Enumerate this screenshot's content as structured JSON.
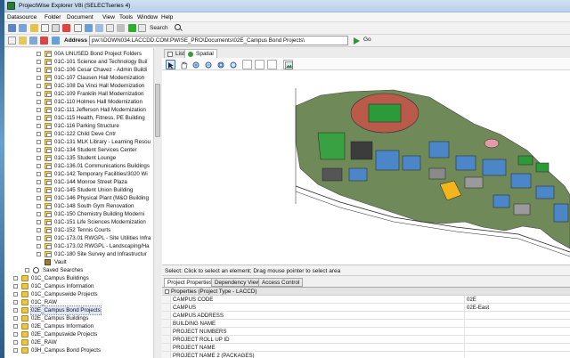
{
  "window": {
    "title": "ProjectWise Explorer V8i (SELECTseries 4)"
  },
  "menu": [
    "Datasource",
    "Folder",
    "Document",
    "View",
    "Tools",
    "Window",
    "Help"
  ],
  "toolbar": {
    "search_label": "Search",
    "address_label": "Address",
    "address_value": "pw:\\\\DOWN034.LACCDD.COM:PWISE_PRO\\Documents\\02E_Campus Bond Projects\\",
    "go_label": "Go"
  },
  "tree": {
    "items": [
      {
        "label": "00A UNUSED Bond Project Folders",
        "type": "project",
        "indent": 3,
        "expander": true
      },
      {
        "label": "01C-101 Science and Technology Buil",
        "type": "project",
        "indent": 3,
        "expander": true
      },
      {
        "label": "01C-106 Cesar Chavez - Admin Buildi",
        "type": "project",
        "indent": 3,
        "expander": true
      },
      {
        "label": "01C-107 Clausen Hall Modernization",
        "type": "project",
        "indent": 3,
        "expander": true
      },
      {
        "label": "01C-108 Da Vinci Hall Modernization",
        "type": "project",
        "indent": 3,
        "expander": true
      },
      {
        "label": "01C-109 Franklin Hall Modernization",
        "type": "project",
        "indent": 3,
        "expander": true
      },
      {
        "label": "01C-110 Holmes Hall Modernization",
        "type": "project",
        "indent": 3,
        "expander": true
      },
      {
        "label": "01C-111 Jefferson Hall Modernization",
        "type": "project",
        "indent": 3,
        "expander": true
      },
      {
        "label": "01C-115 Health, Fitness, PE Building",
        "type": "project",
        "indent": 3,
        "expander": true
      },
      {
        "label": "01C-116 Parking Structure",
        "type": "project",
        "indent": 3,
        "expander": true
      },
      {
        "label": "01C-122 Child Deve Cntr",
        "type": "project",
        "indent": 3,
        "expander": true
      },
      {
        "label": "01C-131 MLK Library - Learning Resou",
        "type": "project",
        "indent": 3,
        "expander": true
      },
      {
        "label": "01C-134 Student Services Center",
        "type": "project",
        "indent": 3,
        "expander": true
      },
      {
        "label": "01C-135 Student Lounge",
        "type": "project",
        "indent": 3,
        "expander": true
      },
      {
        "label": "01C-136.01 Communications Buildings",
        "type": "project",
        "indent": 3,
        "expander": true
      },
      {
        "label": "01C-142 Temporary Facilities/3020 Wi",
        "type": "project",
        "indent": 3,
        "expander": true
      },
      {
        "label": "01C-144 Monroe Street Plaza",
        "type": "project",
        "indent": 3,
        "expander": true
      },
      {
        "label": "01C-145 Student Union Building",
        "type": "project",
        "indent": 3,
        "expander": true
      },
      {
        "label": "01C-146 Physical Plant (M&O Building",
        "type": "project",
        "indent": 3,
        "expander": true
      },
      {
        "label": "01C-148 South Gym Renovation",
        "type": "project",
        "indent": 3,
        "expander": true
      },
      {
        "label": "01C-150 Chemistry Building Moderni",
        "type": "project",
        "indent": 3,
        "expander": true
      },
      {
        "label": "01C-151 Life Sciences Modernization",
        "type": "project",
        "indent": 3,
        "expander": true
      },
      {
        "label": "01C-152 Tennis Courts",
        "type": "project",
        "indent": 3,
        "expander": true
      },
      {
        "label": "01C-173.01 RWGPL - Site Utilities Infra",
        "type": "project",
        "indent": 3,
        "expander": true
      },
      {
        "label": "01C-173.02 RWGPL - Landscaping/Ha",
        "type": "project",
        "indent": 3,
        "expander": true
      },
      {
        "label": "01C-180 Site Survey and Infrastructur",
        "type": "project",
        "indent": 3,
        "expander": true
      },
      {
        "label": "Vault",
        "type": "vault",
        "indent": 3,
        "expander": false
      },
      {
        "label": "Saved Searches",
        "type": "search",
        "indent": 2,
        "expander": true
      },
      {
        "label": "01C_Campus Buildings",
        "type": "folder",
        "indent": 1,
        "expander": true
      },
      {
        "label": "01C_Campus Information",
        "type": "folder",
        "indent": 1,
        "expander": true
      },
      {
        "label": "01C_Campuswide Projects",
        "type": "folder",
        "indent": 1,
        "expander": true
      },
      {
        "label": "01C_RAW",
        "type": "folder",
        "indent": 1,
        "expander": true
      },
      {
        "label": "02E_Campus Bond Projects",
        "type": "folder",
        "indent": 1,
        "expander": true,
        "selected": true
      },
      {
        "label": "02E_Campus Buildings",
        "type": "folder",
        "indent": 1,
        "expander": true
      },
      {
        "label": "02E_Campus Information",
        "type": "folder",
        "indent": 1,
        "expander": true
      },
      {
        "label": "02E_Campuswide Projects",
        "type": "folder",
        "indent": 1,
        "expander": true
      },
      {
        "label": "02E_RAW",
        "type": "folder",
        "indent": 1,
        "expander": true
      },
      {
        "label": "03H_Campus Bond Projects",
        "type": "folder",
        "indent": 1,
        "expander": true
      }
    ]
  },
  "view_tabs": [
    {
      "label": "List",
      "icon": "list-icon"
    },
    {
      "label": "Spatial",
      "icon": "globe-icon",
      "active": true
    }
  ],
  "view_toolbar": {
    "buttons": [
      "select-icon",
      "pan-icon",
      "zoom-in-icon",
      "zoom-out-icon",
      "zoom-window-icon",
      "fit-view-icon",
      "layer-icon",
      "background-icon",
      "map-icon",
      "image-icon"
    ]
  },
  "status_text": "Select: Click to select an element; Drag mouse pointer to select area",
  "property_tabs": [
    "Project Properties",
    "Dependency Viewer",
    "Access Control"
  ],
  "properties": {
    "group_label": "Properties (Project Type - LACCD)",
    "rows": [
      {
        "name": "CAMPUS CODE",
        "value": "02E"
      },
      {
        "name": "CAMPUS",
        "value": "02E-East"
      },
      {
        "name": "CAMPUS ADDRESS",
        "value": ""
      },
      {
        "name": "BUILDING NAME",
        "value": ""
      },
      {
        "name": "PROJECT NUMBERS",
        "value": ""
      },
      {
        "name": "PROJECT ROLL UP ID",
        "value": ""
      },
      {
        "name": "PROJECT NAME",
        "value": ""
      },
      {
        "name": "PROJECT NAME 2 (PACKAGES)",
        "value": ""
      }
    ]
  },
  "colors": {
    "title_bg": "#c6daee",
    "accent": "#4a6ea8",
    "folder": "#e8c64a",
    "go_arrow": "#2b9a2b"
  }
}
